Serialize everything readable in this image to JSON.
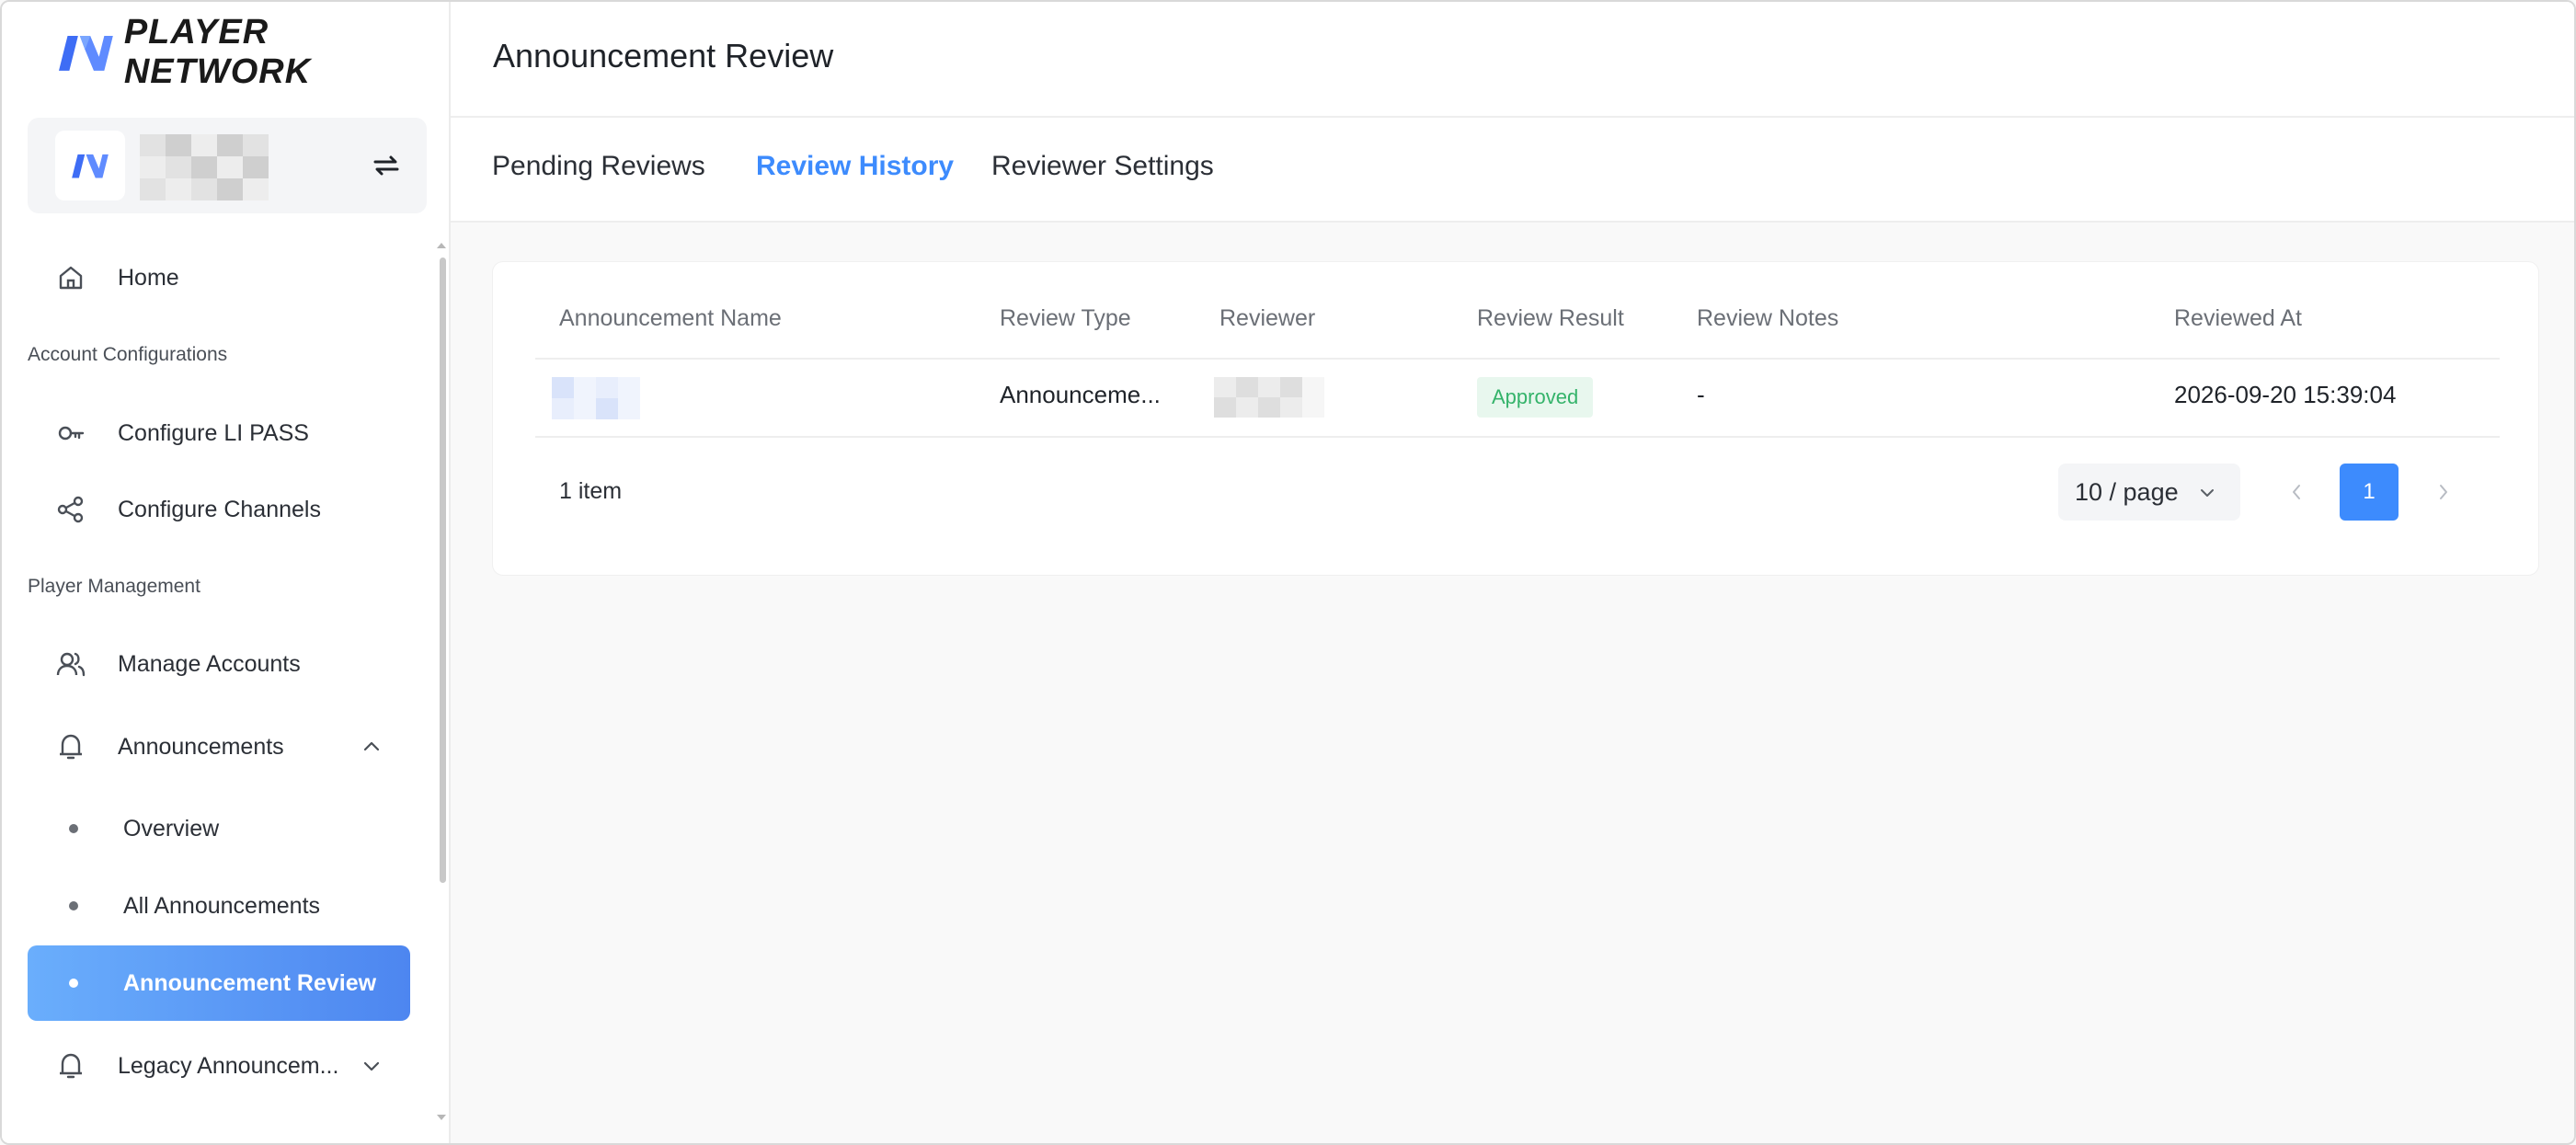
{
  "brand": {
    "name": "PLAYER NETWORK"
  },
  "header": {
    "title": "Announcement Review"
  },
  "tabs": [
    {
      "label": "Pending Reviews",
      "active": false
    },
    {
      "label": "Review History",
      "active": true
    },
    {
      "label": "Reviewer Settings",
      "active": false
    }
  ],
  "sidebar": {
    "home": "Home",
    "group_account": "Account Configurations",
    "configure_li_pass": "Configure LI PASS",
    "configure_channels": "Configure Channels",
    "group_player": "Player Management",
    "manage_accounts": "Manage Accounts",
    "announcements": "Announcements",
    "overview": "Overview",
    "all_announcements": "All Announcements",
    "announcement_review": "Announcement Review",
    "legacy_announcements": "Legacy Announcem..."
  },
  "table": {
    "columns": [
      "Announcement Name",
      "Review Type",
      "Reviewer",
      "Review Result",
      "Review Notes",
      "Reviewed At"
    ],
    "rows": [
      {
        "review_type": "Announceme...",
        "result": "Approved",
        "notes": "-",
        "reviewed_at": "2026-09-20 15:39:04"
      }
    ]
  },
  "pagination": {
    "total": "1 item",
    "page_size": "10 / page",
    "current_page": "1"
  },
  "colors": {
    "accent": "#3d8bfd",
    "active_gradient_start": "#6aaefc",
    "active_gradient_end": "#4d86f0",
    "approved_text": "#34b36a",
    "approved_bg": "#e8f7ee"
  },
  "icons": [
    "logo-icon",
    "switch-icon",
    "home-icon",
    "key-icon",
    "share-icon",
    "users-icon",
    "bell-icon",
    "chevron-up-icon",
    "chevron-down-icon",
    "chevron-left-icon",
    "chevron-right-icon"
  ]
}
